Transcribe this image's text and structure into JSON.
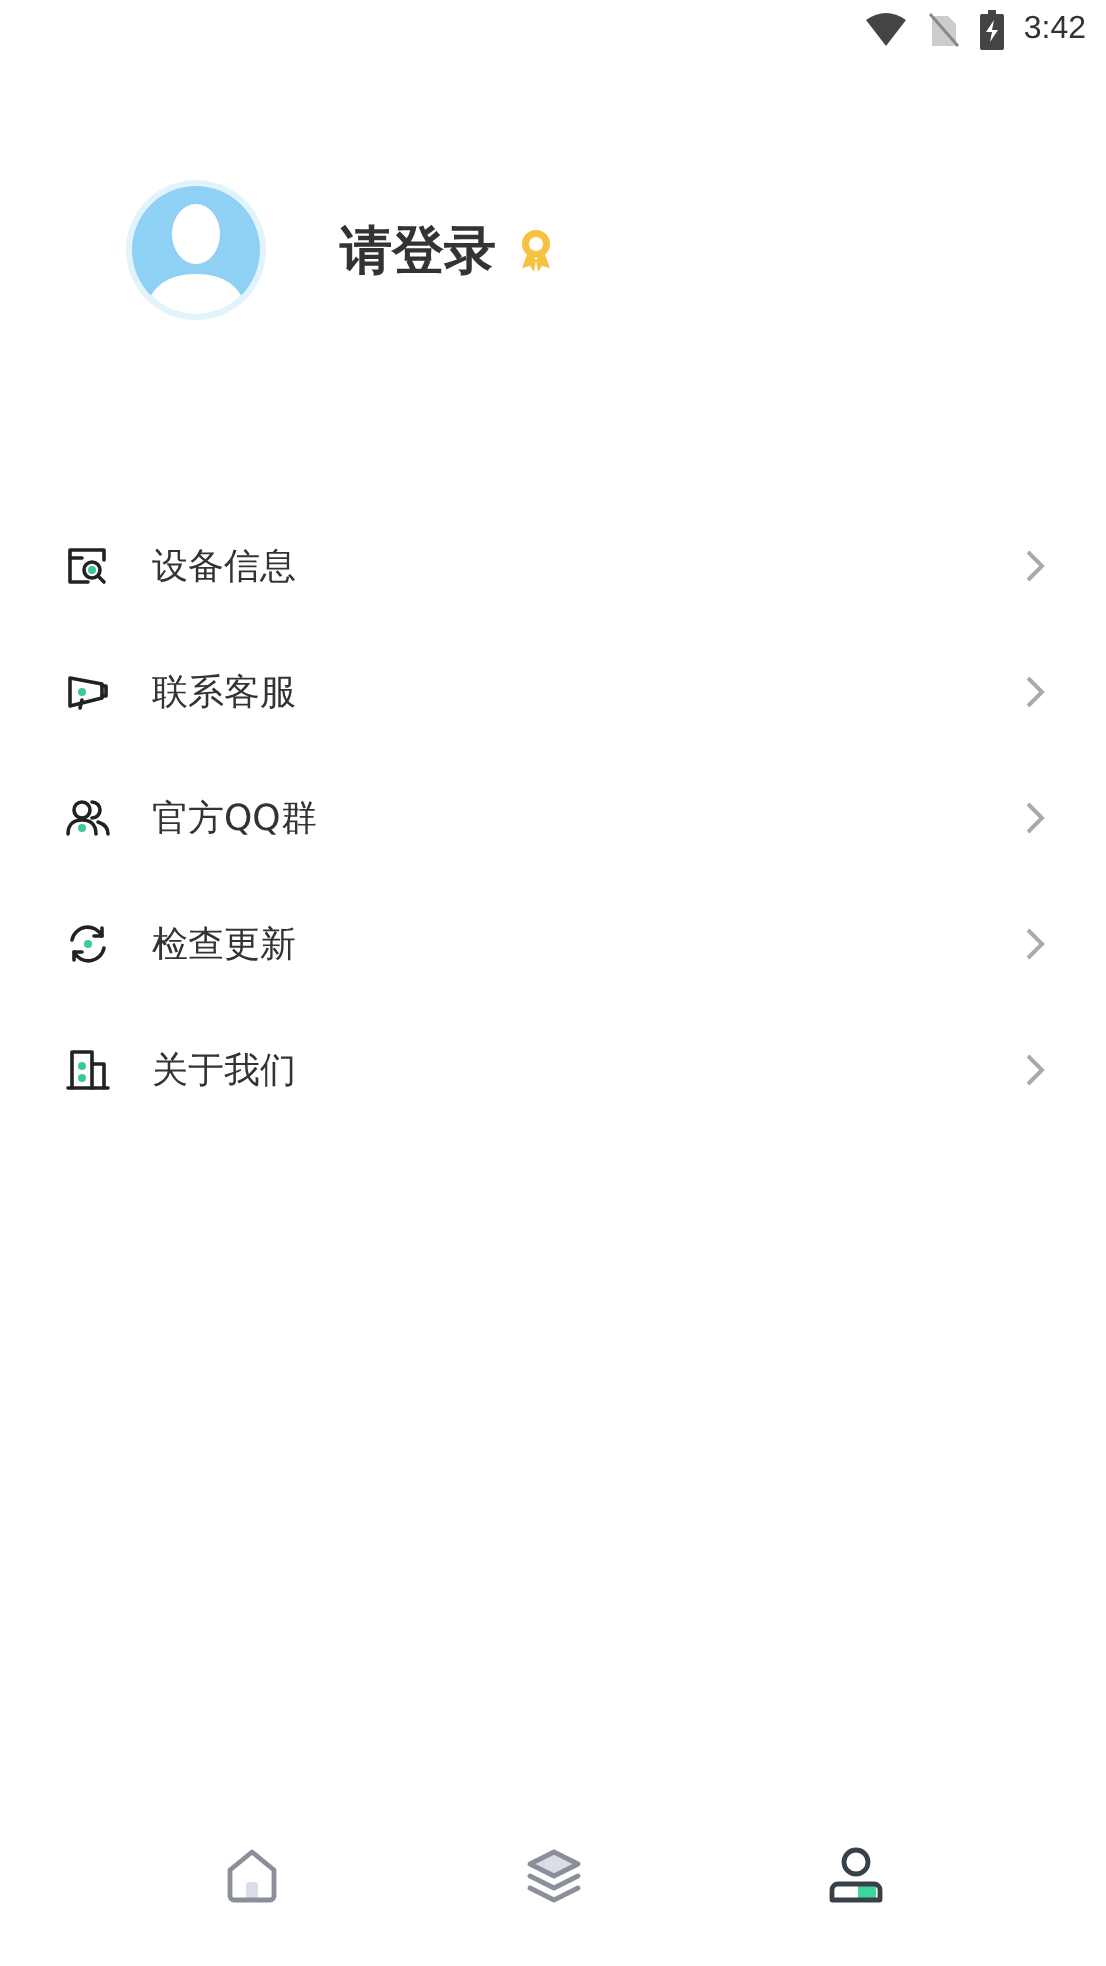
{
  "status_bar": {
    "time": "3:42"
  },
  "profile": {
    "name": "请登录"
  },
  "menu": [
    {
      "kind": "device",
      "label": "设备信息"
    },
    {
      "kind": "service",
      "label": "联系客服"
    },
    {
      "kind": "group",
      "label": "官方QQ群"
    },
    {
      "kind": "update",
      "label": "检查更新"
    },
    {
      "kind": "about",
      "label": "关于我们"
    }
  ],
  "tabs": [
    {
      "kind": "home",
      "selected": false
    },
    {
      "kind": "layers",
      "selected": false
    },
    {
      "kind": "profile",
      "selected": true
    }
  ]
}
